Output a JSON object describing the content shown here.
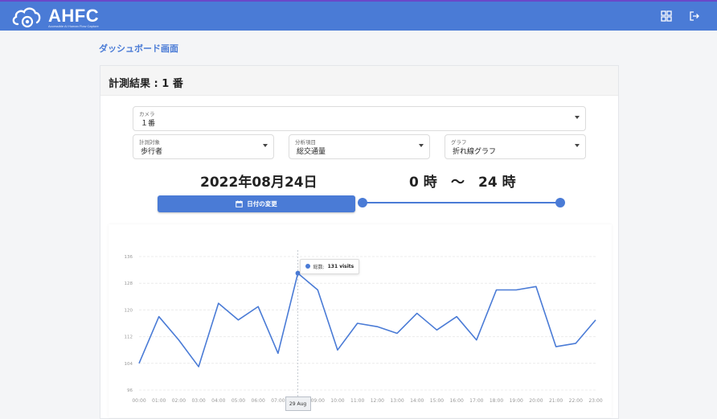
{
  "header": {
    "brand": "AHFC",
    "brand_subtitle": "Accessible AI Human Flow Capture",
    "icons": [
      "dashboard-grid-icon",
      "logout-icon"
    ],
    "accent_color": "#4a7bd6"
  },
  "page_title": "ダッシュボード画面",
  "card_title": "計測結果 : 1 番",
  "filters": {
    "camera": {
      "label": "カメラ",
      "value": "１番"
    },
    "target": {
      "label": "計測対象",
      "value": "歩行者"
    },
    "analysis": {
      "label": "分析項目",
      "value": "総交通量"
    },
    "graph": {
      "label": "グラフ",
      "value": "折れ線グラフ"
    }
  },
  "date_display": "2022年08月24日",
  "time_range": {
    "start": "0 時",
    "separator": "〜",
    "end": "24 時"
  },
  "slider": {
    "min_hour": 0,
    "max_hour": 24,
    "start_hour": 0,
    "end_hour": 24
  },
  "date_button_label": "日付の変更",
  "chart_data": {
    "type": "line",
    "categories": [
      "00:00",
      "01:00",
      "02:00",
      "03:00",
      "04:00",
      "05:00",
      "06:00",
      "07:00",
      "08:00",
      "09:00",
      "10:00",
      "11:00",
      "12:00",
      "13:00",
      "14:00",
      "15:00",
      "16:00",
      "17:00",
      "18:00",
      "19:00",
      "20:00",
      "21:00",
      "22:00",
      "23:00"
    ],
    "series": [
      {
        "name": "総数",
        "values": [
          104,
          118,
          111,
          103,
          122,
          117,
          121,
          107,
          131,
          126,
          108,
          116,
          115,
          113,
          119,
          114,
          118,
          111,
          126,
          126,
          127,
          109,
          110,
          117
        ]
      }
    ],
    "ylim": [
      96,
      136
    ],
    "yticks": [
      96,
      104,
      112,
      120,
      128,
      136
    ],
    "grid": true,
    "color": "#4a7bd6",
    "tooltip": {
      "series": "総数:",
      "value": "131 visits"
    },
    "crosshair_label": "29 Aug",
    "highlight_index": 8
  }
}
